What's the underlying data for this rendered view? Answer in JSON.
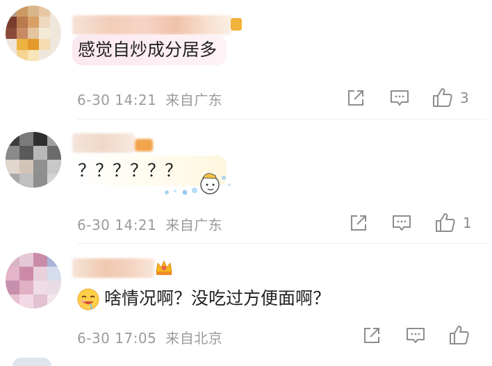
{
  "comments": [
    {
      "text": "感觉自炒成分居多",
      "time": "6-30 14:21",
      "location": "来自广东",
      "like_count": "3"
    },
    {
      "text": "？？？？？？",
      "time": "6-30 14:21",
      "location": "来自广东",
      "like_count": "1"
    },
    {
      "text": "啥情况啊？没吃过方便面啊？",
      "time": "6-30 17:05",
      "location": "来自北京",
      "like_count": ""
    }
  ],
  "icons": {
    "share": "share-icon",
    "comment": "comment-icon",
    "like": "thumbs-up-icon",
    "emoji": "drooling-face-emoji-icon",
    "sticker": "cartoon-sticker-icon",
    "crown": "crown-badge-icon",
    "vip": "vip-badge-icon"
  },
  "colors": {
    "meta_text": "#9b9b9b",
    "divider": "#ededed",
    "bubble_pink": "#fbeaf0",
    "bubble_yellow": "#fff9e4"
  }
}
